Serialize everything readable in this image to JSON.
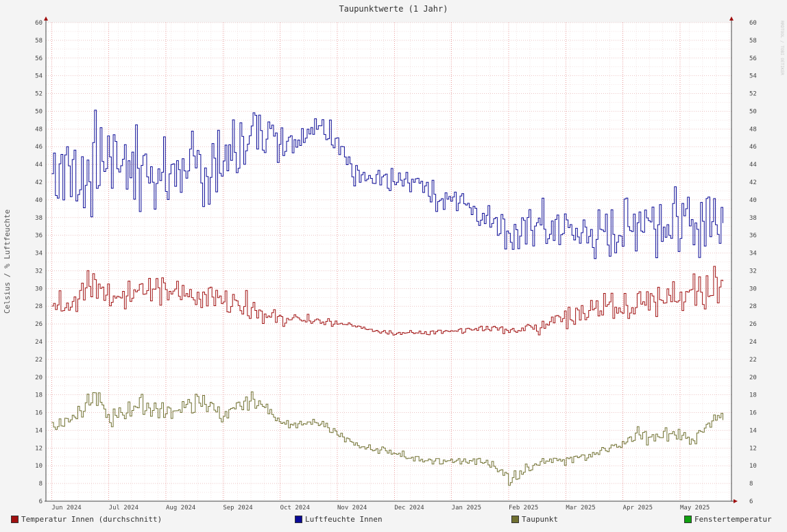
{
  "chart_data": {
    "type": "line",
    "title": "Taupunktwerte (1 Jahr)",
    "ylabel": "Celsius / % Luftfeuchte",
    "watermark": "RRDTOOL / TOBI OETIKER",
    "ylim": [
      6,
      60
    ],
    "yticks": [
      6,
      8,
      10,
      12,
      14,
      16,
      18,
      20,
      22,
      24,
      26,
      28,
      30,
      32,
      34,
      36,
      38,
      40,
      42,
      44,
      46,
      48,
      50,
      52,
      54,
      56,
      58,
      60
    ],
    "x_month_labels": [
      "Jun 2024",
      "Jul 2024",
      "Aug 2024",
      "Sep 2024",
      "Oct 2024",
      "Nov 2024",
      "Dec 2024",
      "Jan 2025",
      "Feb 2025",
      "Mar 2025",
      "Apr 2025",
      "May 2025"
    ],
    "x_unit": "month (0 = 1 Jun 2024)",
    "xlim": [
      -0.1,
      11.9
    ],
    "grid": true,
    "legend_position": "bottom",
    "series": [
      {
        "name": "Luftfeuchte Innen",
        "color": "#0a0a96",
        "x": [
          0,
          0.25,
          0.5,
          0.75,
          1,
          1.25,
          1.5,
          1.75,
          2,
          2.25,
          2.5,
          2.75,
          3,
          3.25,
          3.5,
          3.75,
          4,
          4.25,
          4.5,
          4.75,
          5,
          5.25,
          5.5,
          5.75,
          6,
          6.25,
          6.5,
          6.75,
          7,
          7.25,
          7.5,
          7.75,
          8,
          8.25,
          8.5,
          8.75,
          9,
          9.25,
          9.5,
          9.75,
          10,
          10.25,
          10.5,
          10.75,
          11,
          11.25,
          11.5,
          11.75
        ],
        "values": [
          43,
          44,
          42,
          44,
          45,
          45,
          43,
          44,
          42,
          44,
          43,
          43,
          45,
          45,
          48,
          48,
          47,
          47,
          48,
          48,
          47,
          43,
          42,
          42,
          42,
          42,
          42,
          40,
          40,
          40,
          38,
          38,
          36,
          36,
          38,
          36,
          37,
          36,
          36,
          36,
          37,
          38,
          38,
          38,
          37,
          37,
          38,
          39
        ],
        "amplitude": [
          3,
          3,
          3,
          4,
          3,
          4,
          4,
          4,
          3,
          3,
          3,
          3,
          3,
          3,
          2,
          2,
          2,
          1.5,
          1.2,
          1.2,
          1,
          1,
          1,
          1,
          1,
          1,
          1,
          1,
          1,
          1,
          1,
          1,
          1.5,
          1.5,
          2,
          2,
          2,
          2,
          2,
          2,
          2.5,
          3,
          3,
          3,
          3,
          3,
          3,
          3
        ]
      },
      {
        "name": "Temperatur Innen (durchschnitt)",
        "color": "#a01010",
        "x": [
          0,
          0.25,
          0.5,
          0.75,
          1,
          1.25,
          1.5,
          1.75,
          2,
          2.25,
          2.5,
          2.75,
          3,
          3.25,
          3.5,
          3.75,
          4,
          4.25,
          4.5,
          4.75,
          5,
          5.25,
          5.5,
          5.75,
          6,
          6.25,
          6.5,
          6.75,
          7,
          7.25,
          7.5,
          7.75,
          8,
          8.25,
          8.5,
          8.75,
          9,
          9.25,
          9.5,
          9.75,
          10,
          10.25,
          10.5,
          10.75,
          11,
          11.25,
          11.5,
          11.75
        ],
        "values": [
          28,
          28.5,
          29.5,
          30.5,
          29,
          29,
          30.5,
          30,
          29.5,
          29.5,
          29,
          29.5,
          28.5,
          28.5,
          28,
          27,
          26.5,
          26.5,
          26.5,
          26.2,
          26,
          25.8,
          25.5,
          25.2,
          25,
          25,
          25,
          25.1,
          25.1,
          25.3,
          25.5,
          25.5,
          25.3,
          25.5,
          25.8,
          26.5,
          26.8,
          27.2,
          27.5,
          27.8,
          27.8,
          28.2,
          28.5,
          28.8,
          29,
          29.5,
          30,
          30.8
        ],
        "amplitude": [
          1,
          1,
          1.5,
          1.5,
          1,
          1,
          1.5,
          1.5,
          1,
          1,
          1,
          1,
          1,
          1,
          1,
          0.8,
          0.5,
          0.5,
          0.5,
          0.3,
          0.3,
          0.2,
          0.2,
          0.2,
          0.2,
          0.2,
          0.2,
          0.2,
          0.2,
          0.2,
          0.2,
          0.2,
          0.5,
          0.5,
          0.8,
          0.8,
          1,
          1,
          1.2,
          1.2,
          1.2,
          1.5,
          1.5,
          1.5,
          1.5,
          1.5,
          1.5,
          1.5
        ]
      },
      {
        "name": "Taupunkt",
        "color": "#707030",
        "x": [
          0,
          0.25,
          0.5,
          0.75,
          1,
          1.25,
          1.5,
          1.75,
          2,
          2.25,
          2.5,
          2.75,
          3,
          3.25,
          3.5,
          3.75,
          4,
          4.25,
          4.5,
          4.75,
          5,
          5.25,
          5.5,
          5.75,
          6,
          6.25,
          6.5,
          6.75,
          7,
          7.25,
          7.5,
          7.75,
          8,
          8.25,
          8.5,
          8.75,
          9,
          9.25,
          9.5,
          9.75,
          10,
          10.25,
          10.5,
          10.75,
          11,
          11.25,
          11.5,
          11.75
        ],
        "values": [
          14.5,
          15,
          16.5,
          18,
          15,
          16,
          17,
          16.5,
          16,
          16.5,
          17,
          17,
          15.5,
          16.5,
          17.5,
          16.5,
          15,
          14.5,
          14.8,
          14.8,
          13.5,
          12.5,
          12,
          11.8,
          11.5,
          11,
          10.5,
          10.5,
          10.5,
          10.5,
          10.5,
          10,
          8.5,
          9.5,
          10.5,
          10.5,
          10.5,
          11,
          11.5,
          12,
          12.5,
          13.5,
          13,
          13.5,
          13.5,
          13,
          14.5,
          15.8
        ],
        "amplitude": [
          0.6,
          0.6,
          0.8,
          0.8,
          0.8,
          0.8,
          0.8,
          0.8,
          0.6,
          0.6,
          0.8,
          0.8,
          0.6,
          0.6,
          0.6,
          0.4,
          0.3,
          0.3,
          0.3,
          0.3,
          0.3,
          0.3,
          0.3,
          0.3,
          0.3,
          0.3,
          0.3,
          0.3,
          0.3,
          0.3,
          0.3,
          0.3,
          0.6,
          0.5,
          0.4,
          0.4,
          0.4,
          0.4,
          0.4,
          0.4,
          0.5,
          0.6,
          0.6,
          0.6,
          0.6,
          0.6,
          0.6,
          0.6
        ]
      },
      {
        "name": "Fenstertemperatur",
        "color": "#10a010",
        "x": [],
        "values": []
      }
    ]
  }
}
